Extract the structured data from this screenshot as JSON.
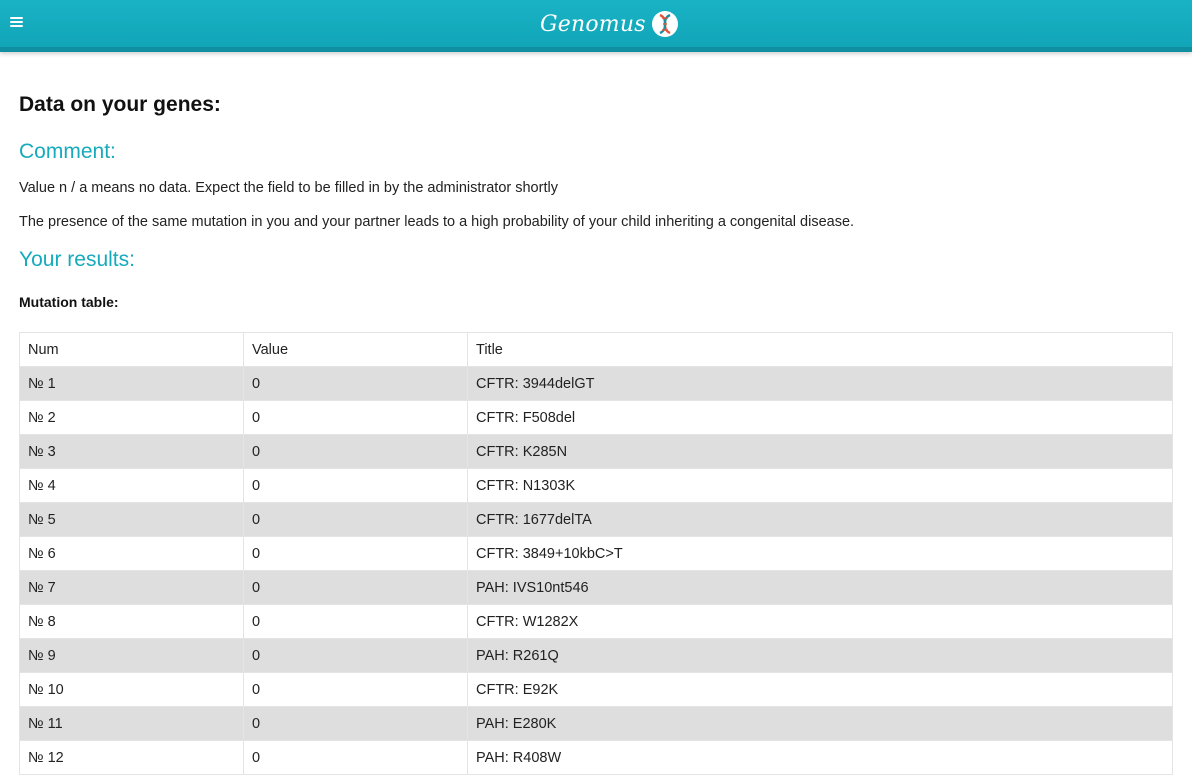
{
  "header": {
    "brand": "Genomus"
  },
  "page": {
    "title": "Data on your genes:",
    "comment_heading": "Comment:",
    "comment_line1": "Value n / a means no data. Expect the field to be filled in by the administrator shortly",
    "comment_line2": "The presence of the same mutation in you and your partner leads to a high probability of your child inheriting a congenital disease.",
    "results_heading": "Your results:",
    "table_caption": "Mutation table:"
  },
  "table": {
    "columns": [
      "Num",
      "Value",
      "Title"
    ],
    "rows": [
      [
        "№ 1",
        "0",
        "CFTR: 3944delGT"
      ],
      [
        "№ 2",
        "0",
        "CFTR: F508del"
      ],
      [
        "№ 3",
        "0",
        "CFTR: K285N"
      ],
      [
        "№ 4",
        "0",
        "CFTR: N1303K"
      ],
      [
        "№ 5",
        "0",
        "CFTR: 1677delTA"
      ],
      [
        "№ 6",
        "0",
        "CFTR: 3849+10kbC>T"
      ],
      [
        "№ 7",
        "0",
        "PAH: IVS10nt546"
      ],
      [
        "№ 8",
        "0",
        "CFTR: W1282X"
      ],
      [
        "№ 9",
        "0",
        "PAH: R261Q"
      ],
      [
        "№ 10",
        "0",
        "CFTR: E92K"
      ],
      [
        "№ 11",
        "0",
        "PAH: E280K"
      ],
      [
        "№ 12",
        "0",
        "PAH: R408W"
      ]
    ]
  },
  "colors": {
    "accent": "#17aabd",
    "topbar": "#11a5b8",
    "row_stripe": "#dedede"
  }
}
